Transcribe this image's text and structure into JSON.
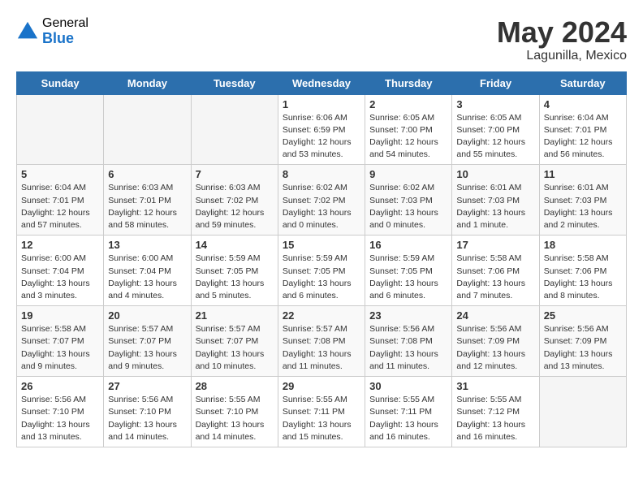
{
  "header": {
    "logo_general": "General",
    "logo_blue": "Blue",
    "month_year": "May 2024",
    "location": "Lagunilla, Mexico"
  },
  "days_of_week": [
    "Sunday",
    "Monday",
    "Tuesday",
    "Wednesday",
    "Thursday",
    "Friday",
    "Saturday"
  ],
  "weeks": [
    [
      {
        "day": "",
        "info": ""
      },
      {
        "day": "",
        "info": ""
      },
      {
        "day": "",
        "info": ""
      },
      {
        "day": "1",
        "info": "Sunrise: 6:06 AM\nSunset: 6:59 PM\nDaylight: 12 hours\nand 53 minutes."
      },
      {
        "day": "2",
        "info": "Sunrise: 6:05 AM\nSunset: 7:00 PM\nDaylight: 12 hours\nand 54 minutes."
      },
      {
        "day": "3",
        "info": "Sunrise: 6:05 AM\nSunset: 7:00 PM\nDaylight: 12 hours\nand 55 minutes."
      },
      {
        "day": "4",
        "info": "Sunrise: 6:04 AM\nSunset: 7:01 PM\nDaylight: 12 hours\nand 56 minutes."
      }
    ],
    [
      {
        "day": "5",
        "info": "Sunrise: 6:04 AM\nSunset: 7:01 PM\nDaylight: 12 hours\nand 57 minutes."
      },
      {
        "day": "6",
        "info": "Sunrise: 6:03 AM\nSunset: 7:01 PM\nDaylight: 12 hours\nand 58 minutes."
      },
      {
        "day": "7",
        "info": "Sunrise: 6:03 AM\nSunset: 7:02 PM\nDaylight: 12 hours\nand 59 minutes."
      },
      {
        "day": "8",
        "info": "Sunrise: 6:02 AM\nSunset: 7:02 PM\nDaylight: 13 hours\nand 0 minutes."
      },
      {
        "day": "9",
        "info": "Sunrise: 6:02 AM\nSunset: 7:03 PM\nDaylight: 13 hours\nand 0 minutes."
      },
      {
        "day": "10",
        "info": "Sunrise: 6:01 AM\nSunset: 7:03 PM\nDaylight: 13 hours\nand 1 minute."
      },
      {
        "day": "11",
        "info": "Sunrise: 6:01 AM\nSunset: 7:03 PM\nDaylight: 13 hours\nand 2 minutes."
      }
    ],
    [
      {
        "day": "12",
        "info": "Sunrise: 6:00 AM\nSunset: 7:04 PM\nDaylight: 13 hours\nand 3 minutes."
      },
      {
        "day": "13",
        "info": "Sunrise: 6:00 AM\nSunset: 7:04 PM\nDaylight: 13 hours\nand 4 minutes."
      },
      {
        "day": "14",
        "info": "Sunrise: 5:59 AM\nSunset: 7:05 PM\nDaylight: 13 hours\nand 5 minutes."
      },
      {
        "day": "15",
        "info": "Sunrise: 5:59 AM\nSunset: 7:05 PM\nDaylight: 13 hours\nand 6 minutes."
      },
      {
        "day": "16",
        "info": "Sunrise: 5:59 AM\nSunset: 7:05 PM\nDaylight: 13 hours\nand 6 minutes."
      },
      {
        "day": "17",
        "info": "Sunrise: 5:58 AM\nSunset: 7:06 PM\nDaylight: 13 hours\nand 7 minutes."
      },
      {
        "day": "18",
        "info": "Sunrise: 5:58 AM\nSunset: 7:06 PM\nDaylight: 13 hours\nand 8 minutes."
      }
    ],
    [
      {
        "day": "19",
        "info": "Sunrise: 5:58 AM\nSunset: 7:07 PM\nDaylight: 13 hours\nand 9 minutes."
      },
      {
        "day": "20",
        "info": "Sunrise: 5:57 AM\nSunset: 7:07 PM\nDaylight: 13 hours\nand 9 minutes."
      },
      {
        "day": "21",
        "info": "Sunrise: 5:57 AM\nSunset: 7:07 PM\nDaylight: 13 hours\nand 10 minutes."
      },
      {
        "day": "22",
        "info": "Sunrise: 5:57 AM\nSunset: 7:08 PM\nDaylight: 13 hours\nand 11 minutes."
      },
      {
        "day": "23",
        "info": "Sunrise: 5:56 AM\nSunset: 7:08 PM\nDaylight: 13 hours\nand 11 minutes."
      },
      {
        "day": "24",
        "info": "Sunrise: 5:56 AM\nSunset: 7:09 PM\nDaylight: 13 hours\nand 12 minutes."
      },
      {
        "day": "25",
        "info": "Sunrise: 5:56 AM\nSunset: 7:09 PM\nDaylight: 13 hours\nand 13 minutes."
      }
    ],
    [
      {
        "day": "26",
        "info": "Sunrise: 5:56 AM\nSunset: 7:10 PM\nDaylight: 13 hours\nand 13 minutes."
      },
      {
        "day": "27",
        "info": "Sunrise: 5:56 AM\nSunset: 7:10 PM\nDaylight: 13 hours\nand 14 minutes."
      },
      {
        "day": "28",
        "info": "Sunrise: 5:55 AM\nSunset: 7:10 PM\nDaylight: 13 hours\nand 14 minutes."
      },
      {
        "day": "29",
        "info": "Sunrise: 5:55 AM\nSunset: 7:11 PM\nDaylight: 13 hours\nand 15 minutes."
      },
      {
        "day": "30",
        "info": "Sunrise: 5:55 AM\nSunset: 7:11 PM\nDaylight: 13 hours\nand 16 minutes."
      },
      {
        "day": "31",
        "info": "Sunrise: 5:55 AM\nSunset: 7:12 PM\nDaylight: 13 hours\nand 16 minutes."
      },
      {
        "day": "",
        "info": ""
      }
    ]
  ]
}
